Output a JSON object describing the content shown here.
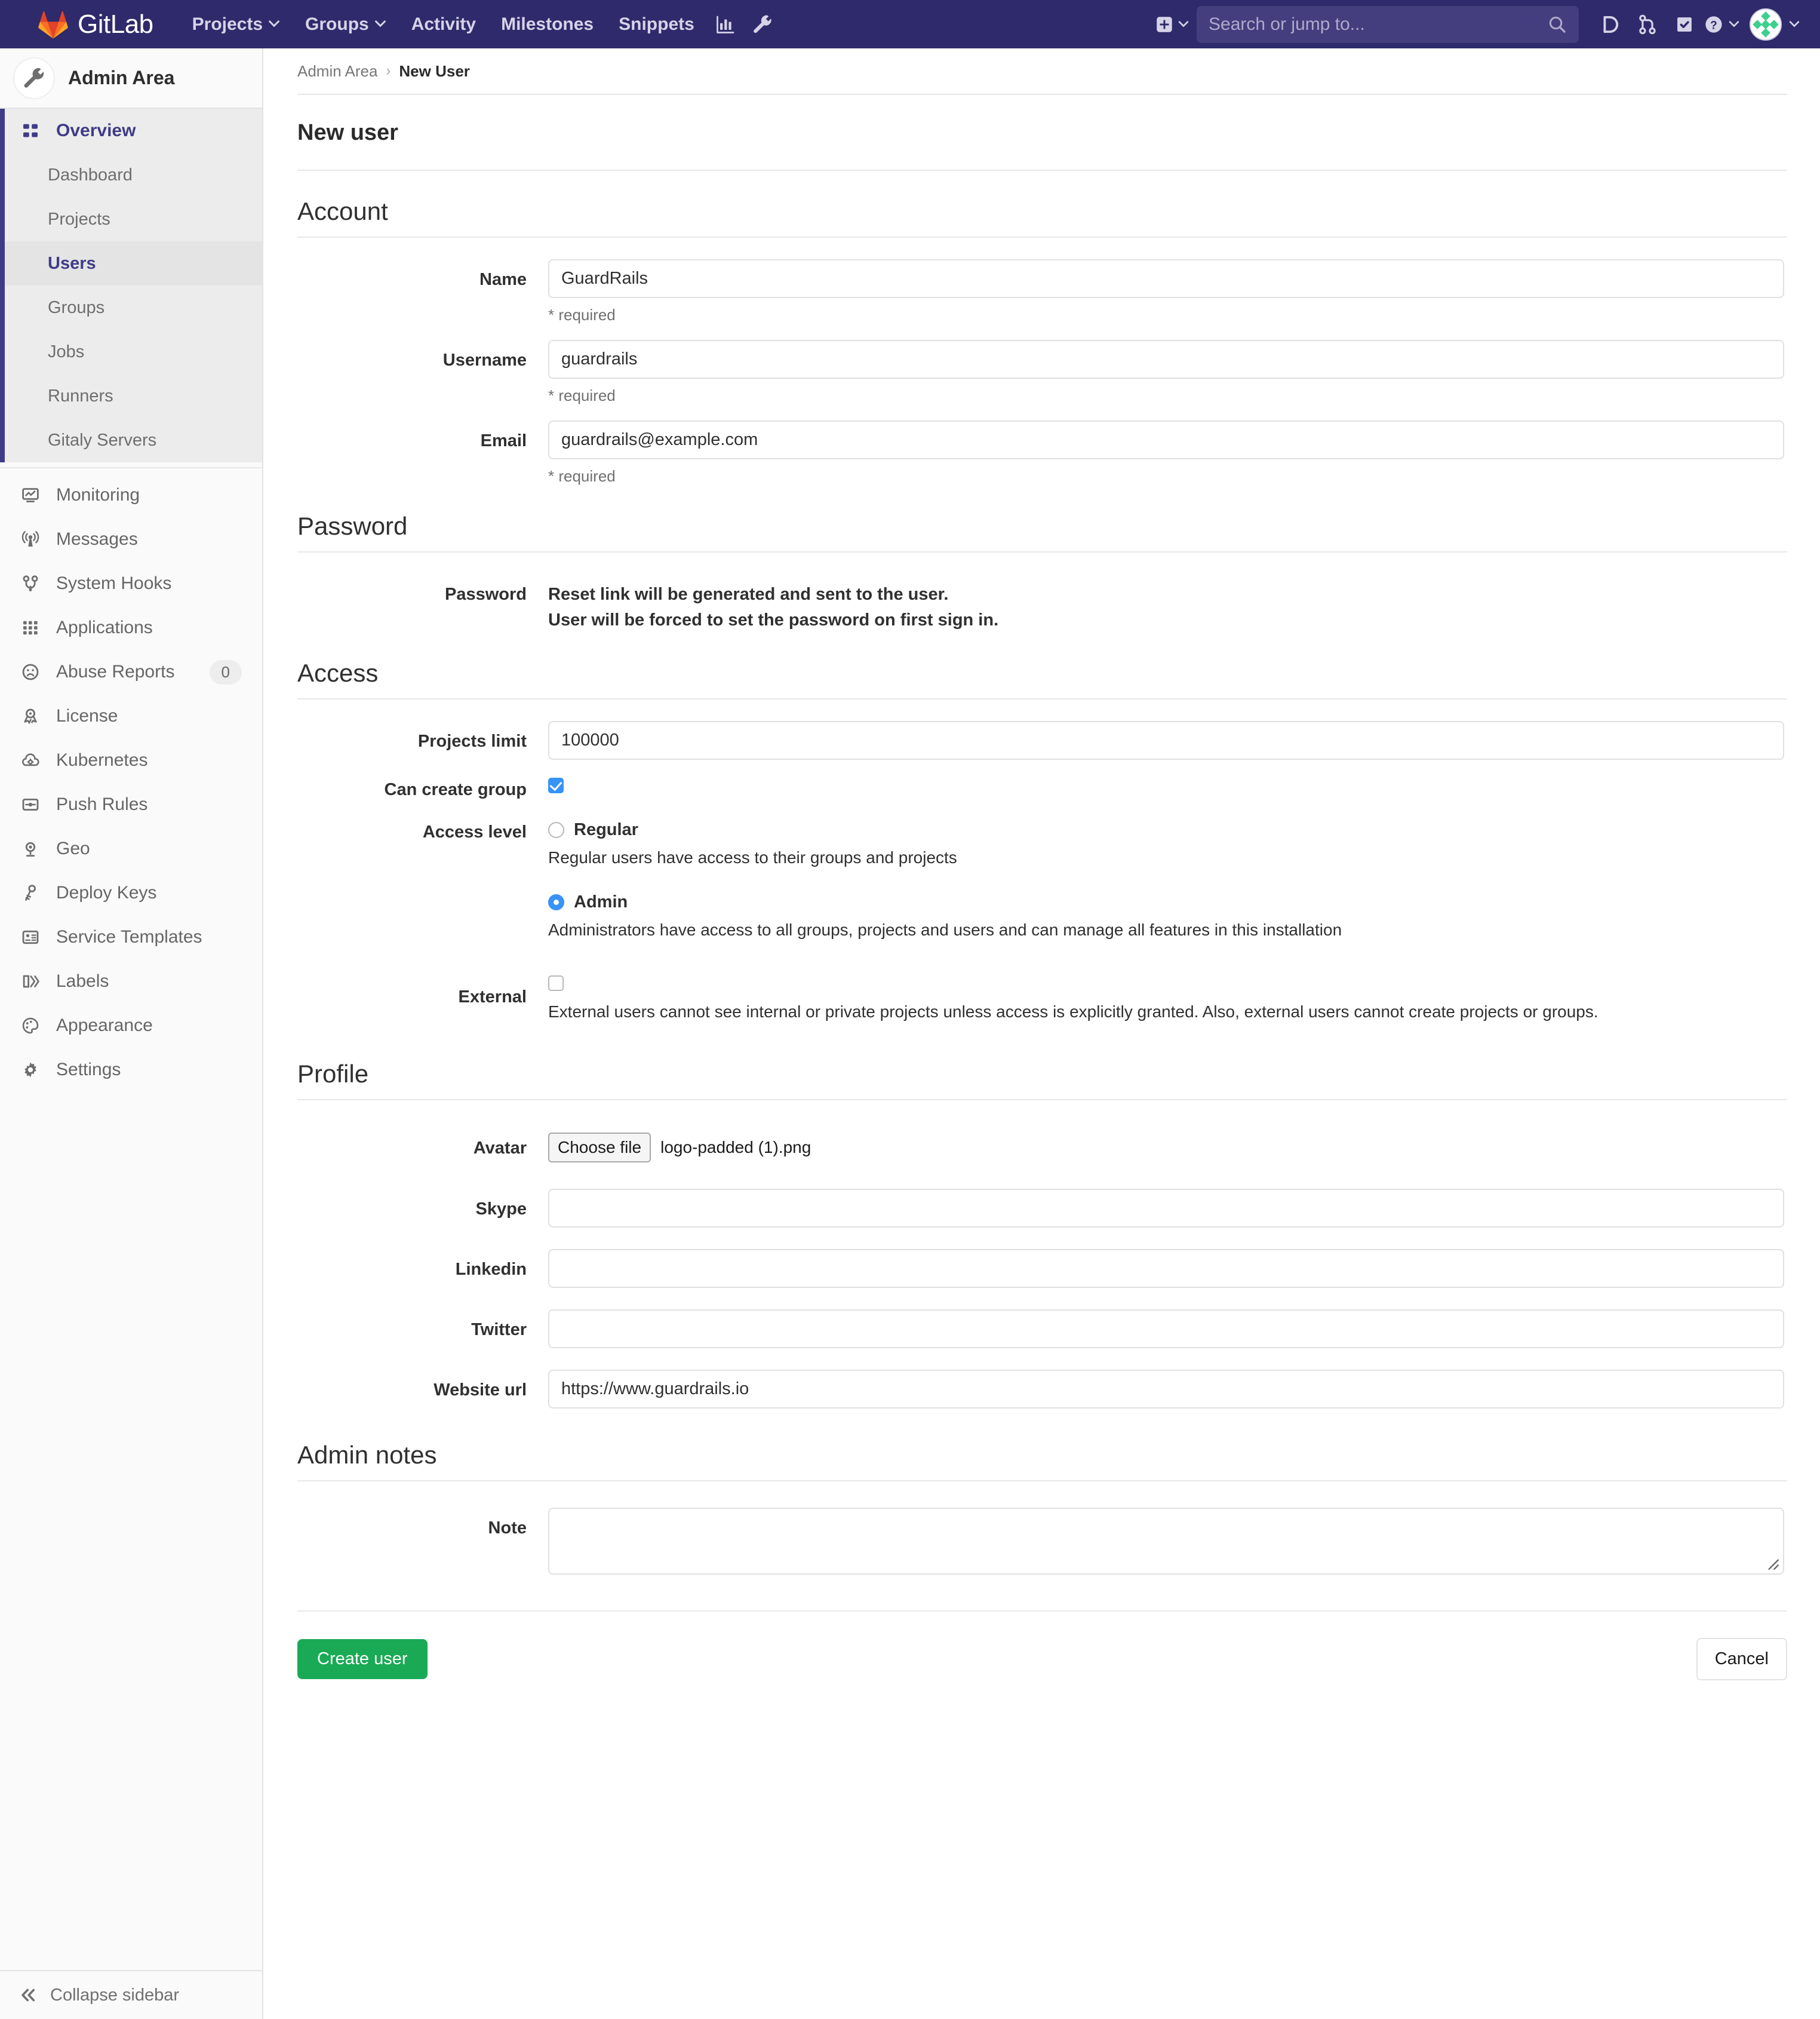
{
  "navbar": {
    "brand": "GitLab",
    "links": [
      {
        "label": "Projects",
        "has_caret": true
      },
      {
        "label": "Groups",
        "has_caret": true
      },
      {
        "label": "Activity",
        "has_caret": false
      },
      {
        "label": "Milestones",
        "has_caret": false
      },
      {
        "label": "Snippets",
        "has_caret": false
      }
    ],
    "left_icons": [
      "analytics-chart-icon",
      "wrench-icon"
    ],
    "create_new_label": "",
    "search": {
      "placeholder": "Search or jump to..."
    },
    "right_icons": [
      "issues-icon",
      "merge-requests-icon",
      "todos-icon",
      "help-icon"
    ],
    "avatar": "user-avatar"
  },
  "sidebar": {
    "title": "Admin Area",
    "overview": {
      "label": "Overview"
    },
    "overview_children": [
      {
        "label": "Dashboard",
        "current": false
      },
      {
        "label": "Projects",
        "current": false
      },
      {
        "label": "Users",
        "current": true
      },
      {
        "label": "Groups",
        "current": false
      },
      {
        "label": "Jobs",
        "current": false
      },
      {
        "label": "Runners",
        "current": false
      },
      {
        "label": "Gitaly Servers",
        "current": false
      }
    ],
    "items": [
      {
        "label": "Monitoring",
        "icon": "monitor-icon",
        "badge": null
      },
      {
        "label": "Messages",
        "icon": "broadcast-icon",
        "badge": null
      },
      {
        "label": "System Hooks",
        "icon": "hook-icon",
        "badge": null
      },
      {
        "label": "Applications",
        "icon": "applications-grid-icon",
        "badge": null
      },
      {
        "label": "Abuse Reports",
        "icon": "sad-face-icon",
        "badge": "0"
      },
      {
        "label": "License",
        "icon": "license-ribbon-icon",
        "badge": null
      },
      {
        "label": "Kubernetes",
        "icon": "kubernetes-cloud-icon",
        "badge": null
      },
      {
        "label": "Push Rules",
        "icon": "push-rules-icon",
        "badge": null
      },
      {
        "label": "Geo",
        "icon": "location-pin-icon",
        "badge": null
      },
      {
        "label": "Deploy Keys",
        "icon": "key-icon",
        "badge": null
      },
      {
        "label": "Service Templates",
        "icon": "template-card-icon",
        "badge": null
      },
      {
        "label": "Labels",
        "icon": "labels-icon",
        "badge": null
      },
      {
        "label": "Appearance",
        "icon": "palette-icon",
        "badge": null
      },
      {
        "label": "Settings",
        "icon": "gear-icon",
        "badge": null
      }
    ],
    "collapse_label": "Collapse sidebar"
  },
  "breadcrumb": {
    "parent": "Admin Area",
    "separator": "›",
    "current": "New User"
  },
  "page": {
    "title": "New user"
  },
  "sections": {
    "account": {
      "heading": "Account",
      "name": {
        "label": "Name",
        "value": "GuardRails",
        "hint": "* required"
      },
      "username": {
        "label": "Username",
        "value": "guardrails",
        "hint": "* required"
      },
      "email": {
        "label": "Email",
        "value": "guardrails@example.com",
        "hint": "* required"
      }
    },
    "password": {
      "heading": "Password",
      "label": "Password",
      "line1": "Reset link will be generated and sent to the user.",
      "line2": "User will be forced to set the password on first sign in."
    },
    "access": {
      "heading": "Access",
      "projects_limit": {
        "label": "Projects limit",
        "value": "100000"
      },
      "can_create_group": {
        "label": "Can create group",
        "checked": true
      },
      "access_level": {
        "label": "Access level",
        "options": [
          {
            "label": "Regular",
            "selected": false,
            "description": "Regular users have access to their groups and projects"
          },
          {
            "label": "Admin",
            "selected": true,
            "description": "Administrators have access to all groups, projects and users and can manage all features in this installation"
          }
        ]
      },
      "external": {
        "label": "External",
        "checked": false,
        "description": "External users cannot see internal or private projects unless access is explicitly granted. Also, external users cannot create projects or groups."
      }
    },
    "profile": {
      "heading": "Profile",
      "avatar": {
        "label": "Avatar",
        "button": "Choose file",
        "file_name": "logo-padded (1).png"
      },
      "skype": {
        "label": "Skype",
        "value": ""
      },
      "linkedin": {
        "label": "Linkedin",
        "value": ""
      },
      "twitter": {
        "label": "Twitter",
        "value": ""
      },
      "website_url": {
        "label": "Website url",
        "value": "https://www.guardrails.io"
      }
    },
    "admin_notes": {
      "heading": "Admin notes",
      "note": {
        "label": "Note",
        "value": ""
      }
    }
  },
  "actions": {
    "create": "Create user",
    "cancel": "Cancel"
  },
  "colors": {
    "navbar_bg": "#2f2a6b",
    "accent": "#3f3c87",
    "primary_button": "#1aaa55",
    "checkbox_on": "#3793f7",
    "sidebar_bg": "#fafafa"
  }
}
